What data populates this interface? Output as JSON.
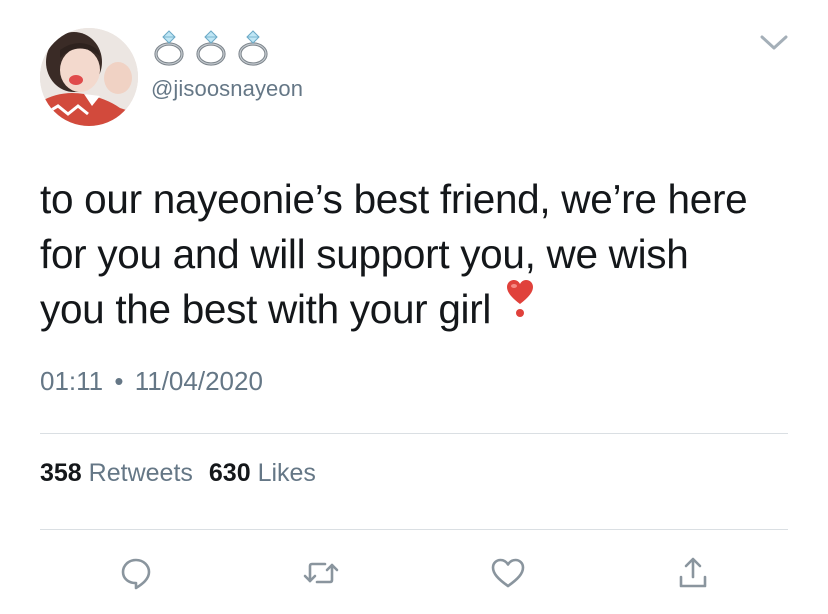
{
  "header": {
    "display_name_icons": [
      "ring-icon",
      "ring-icon",
      "ring-icon"
    ],
    "handle": "@jisoosnayeon"
  },
  "tweet": {
    "lines": [
      "to our nayeonie’s best friend, we’re here",
      "for you and will support you, we wish",
      "you the best with your girl"
    ],
    "emoji": "heavy-heart-exclamation-icon",
    "time": "01:11",
    "separator": "•",
    "date": "11/04/2020"
  },
  "stats": {
    "retweets_count": "358",
    "retweets_label": "Retweets",
    "likes_count": "630",
    "likes_label": "Likes"
  },
  "actions": [
    "reply-icon",
    "retweet-icon",
    "like-icon",
    "share-icon"
  ],
  "colors": {
    "text": "#14171a",
    "secondary": "#657786",
    "divider": "#dadfe3",
    "heart": "#e0413b",
    "icon_gray": "#8a959e"
  }
}
